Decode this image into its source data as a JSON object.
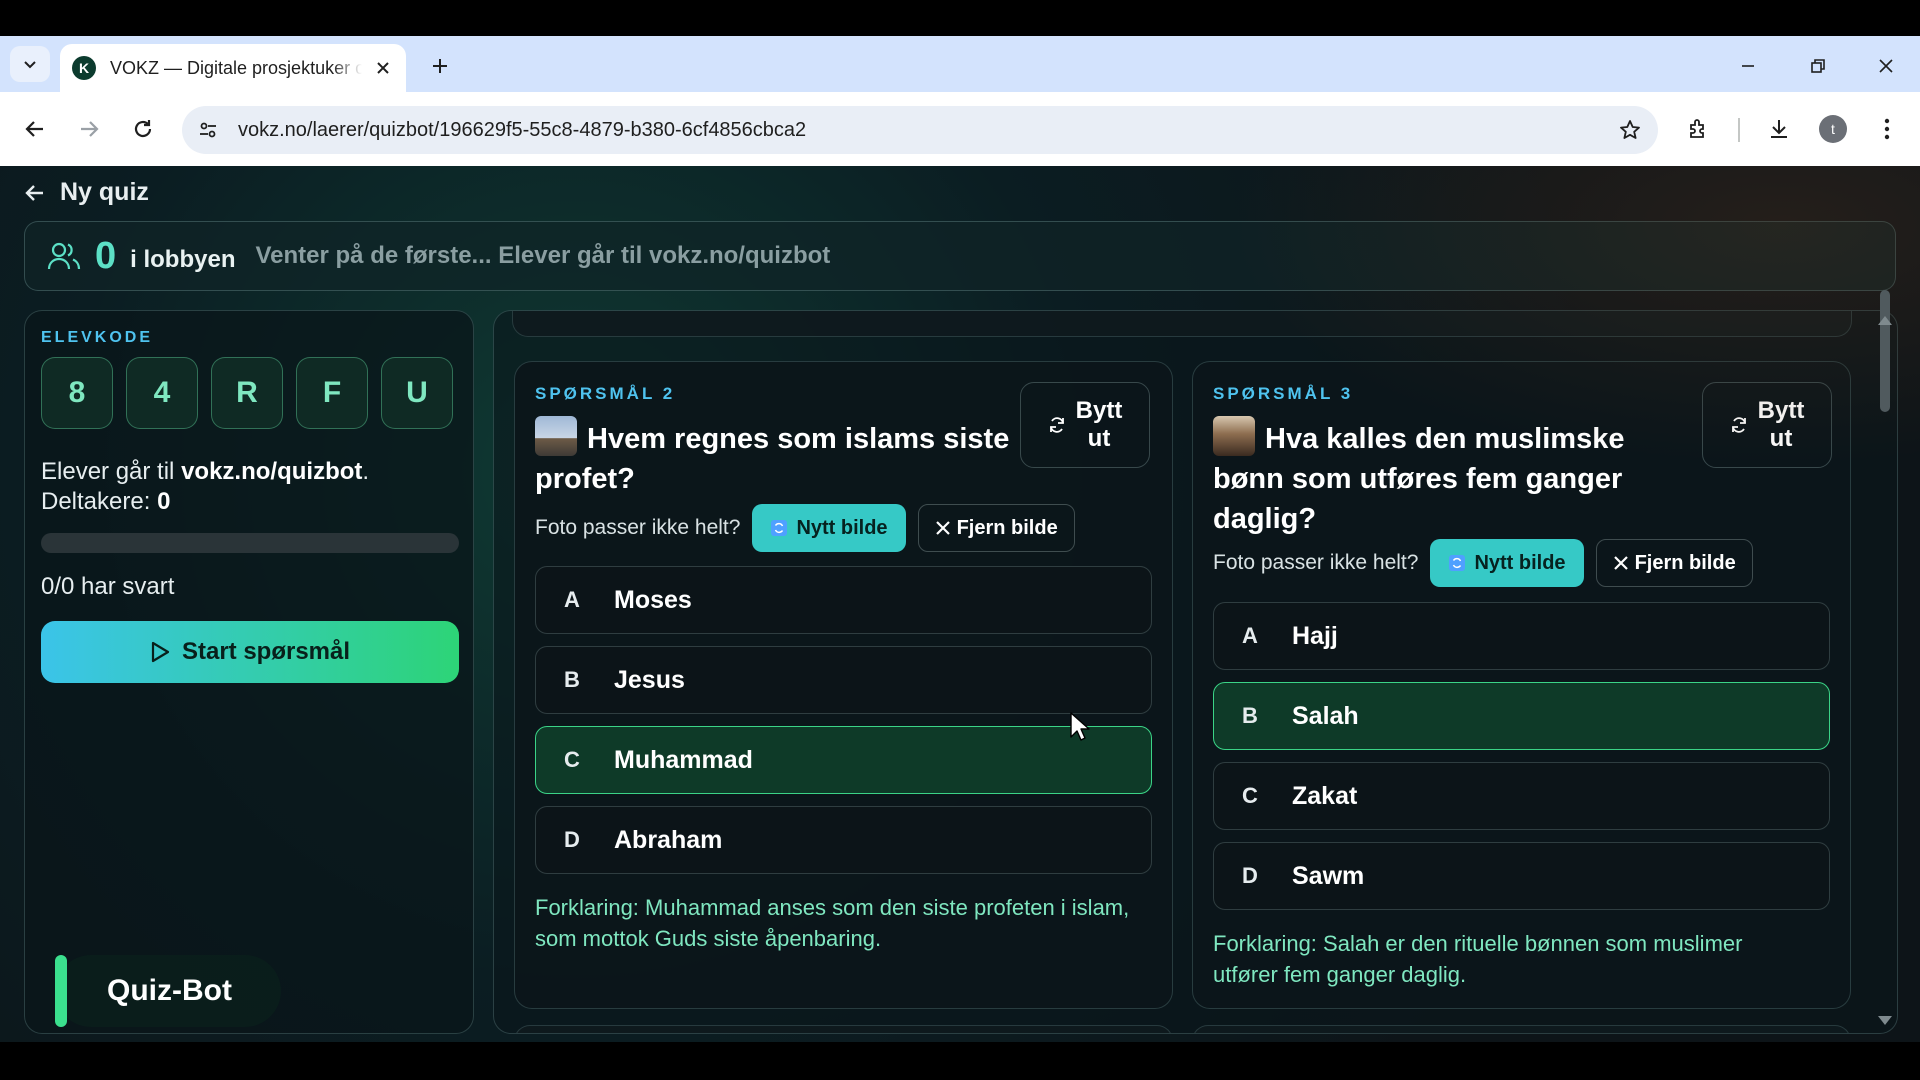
{
  "browser": {
    "tab_title": "VOKZ — Digitale prosjektuker og quiz",
    "favicon_letter": "K",
    "url": "vokz.no/laerer/quizbot/196629f5-55c8-4879-b380-6cf4856cbca2",
    "profile_initial": "t"
  },
  "header": {
    "title": "Ny quiz"
  },
  "lobby": {
    "count": "0",
    "label": "i lobbyen",
    "message": "Venter på de første... Elever går til vokz.no/quizbot"
  },
  "sidebar": {
    "code_label": "ELEVKODE",
    "code": [
      "8",
      "4",
      "R",
      "F",
      "U"
    ],
    "instructions_prefix": "Elever går til ",
    "instructions_link": "vokz.no/quizbot",
    "instructions_suffix": ".",
    "participants_label": "Deltakere: ",
    "participants_value": "0",
    "progress": 0,
    "answered": "0/0 har svart",
    "start_button": "Start spørsmål",
    "brand": "Quiz-Bot"
  },
  "questions": [
    {
      "label": "SPØRSMÅL 2",
      "text": "Hvem regnes som islams siste profet?",
      "swap_label_1": "Bytt",
      "swap_label_2": "ut",
      "photo_question": "Foto passer ikke helt?",
      "new_image": "Nytt bilde",
      "remove_image": "Fjern bilde",
      "answers": [
        {
          "letter": "A",
          "text": "Moses"
        },
        {
          "letter": "B",
          "text": "Jesus"
        },
        {
          "letter": "C",
          "text": "Muhammad"
        },
        {
          "letter": "D",
          "text": "Abraham"
        }
      ],
      "explanation": "Forklaring: Muhammad anses som den siste profeten i islam, som mottok Guds siste åpenbaring."
    },
    {
      "label": "SPØRSMÅL 3",
      "text": "Hva kalles den muslimske bønn som utføres fem ganger daglig?",
      "swap_label_1": "Bytt",
      "swap_label_2": "ut",
      "photo_question": "Foto passer ikke helt?",
      "new_image": "Nytt bilde",
      "remove_image": "Fjern bilde",
      "answers": [
        {
          "letter": "A",
          "text": "Hajj"
        },
        {
          "letter": "B",
          "text": "Salah"
        },
        {
          "letter": "C",
          "text": "Zakat"
        },
        {
          "letter": "D",
          "text": "Sawm"
        }
      ],
      "explanation": "Forklaring: Salah er den rituelle bønnen som muslimer utfører fem ganger daglig."
    }
  ],
  "colors": {
    "accent_blue": "#4fc3ef",
    "accent_green": "#3bd487",
    "correct_bg": "#0e3a28"
  }
}
